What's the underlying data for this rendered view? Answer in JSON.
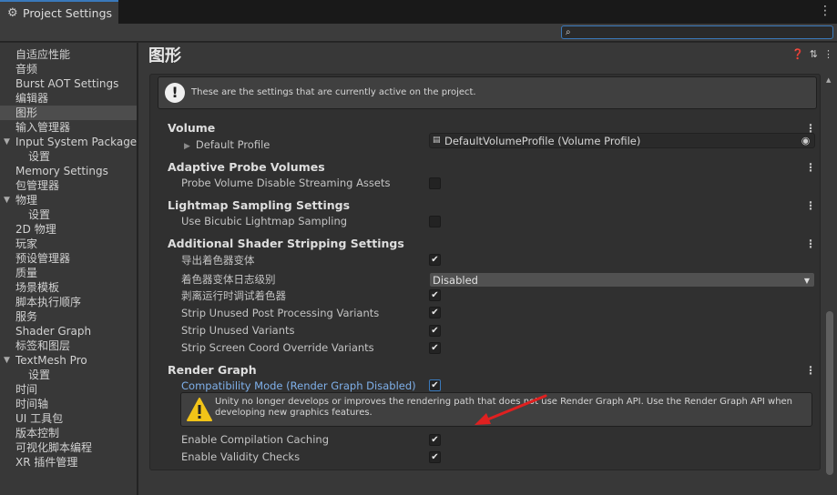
{
  "window": {
    "tab_title": "Project Settings",
    "tab_icon": "gear-icon"
  },
  "search": {
    "placeholder": "",
    "value": ""
  },
  "sidebar": {
    "items": [
      {
        "label": "自适应性能"
      },
      {
        "label": "音频"
      },
      {
        "label": "Burst AOT Settings"
      },
      {
        "label": "编辑器"
      },
      {
        "label": "图形",
        "selected": true
      },
      {
        "label": "输入管理器"
      },
      {
        "label": "Input System Package",
        "expanded": true
      },
      {
        "label": "设置"
      },
      {
        "label": "Memory Settings"
      },
      {
        "label": "包管理器"
      },
      {
        "label": "物理",
        "expanded": true
      },
      {
        "label": "设置"
      },
      {
        "label": "2D 物理"
      },
      {
        "label": "玩家"
      },
      {
        "label": "预设管理器"
      },
      {
        "label": "质量"
      },
      {
        "label": "场景模板"
      },
      {
        "label": "脚本执行顺序"
      },
      {
        "label": "服务"
      },
      {
        "label": "Shader Graph"
      },
      {
        "label": "标签和图层"
      },
      {
        "label": "TextMesh Pro",
        "expanded": true
      },
      {
        "label": "设置"
      },
      {
        "label": "时间"
      },
      {
        "label": "时间轴"
      },
      {
        "label": "UI 工具包"
      },
      {
        "label": "版本控制"
      },
      {
        "label": "可视化脚本编程"
      },
      {
        "label": "XR 插件管理"
      }
    ]
  },
  "main": {
    "title": "图形",
    "info": "These are the settings that are currently active on the project.",
    "sections": {
      "volume": {
        "title": "Volume",
        "default_profile_label": "Default Profile",
        "default_profile_value": "DefaultVolumeProfile (Volume Profile)"
      },
      "apv": {
        "title": "Adaptive Probe Volumes",
        "row1": "Probe Volume Disable Streaming Assets",
        "row1_checked": false
      },
      "lightmap": {
        "title": "Lightmap Sampling Settings",
        "row1": "Use Bicubic Lightmap Sampling",
        "row1_checked": false
      },
      "stripping": {
        "title": "Additional Shader Stripping Settings",
        "export_variants": "导出着色器变体",
        "log_level_label": "着色器变体日志级别",
        "log_level_value": "Disabled",
        "strip_runtime_debug": "剥离运行时调试着色器",
        "strip_post": "Strip Unused Post Processing Variants",
        "strip_unused": "Strip Unused Variants",
        "strip_screen": "Strip Screen Coord Override Variants"
      },
      "render_graph": {
        "title": "Render Graph",
        "compat_mode": "Compatibility Mode (Render Graph Disabled)",
        "warning": "Unity no longer develops or improves the rendering path that does not use Render Graph API. Use the Render Graph API when developing new graphics features.",
        "compilation_caching": "Enable Compilation Caching",
        "validity_checks": "Enable Validity Checks"
      }
    }
  },
  "colors": {
    "accent": "#3a79bb",
    "link": "#7fb0ea",
    "arrow": "#e02020",
    "warning": "#f2c418"
  }
}
